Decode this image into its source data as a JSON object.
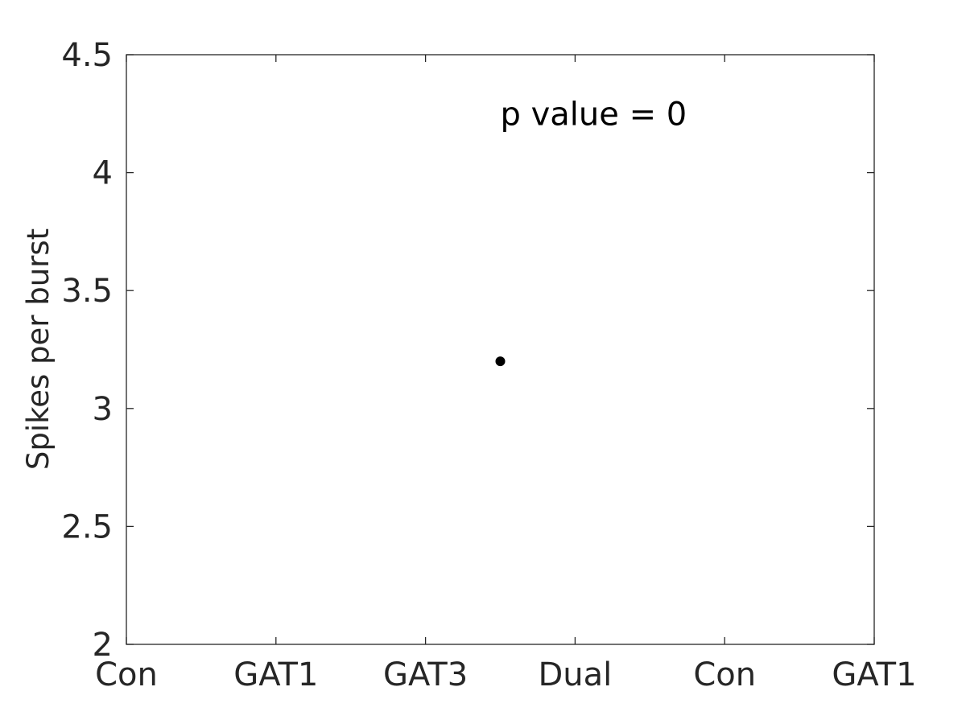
{
  "chart_data": {
    "type": "scatter",
    "title": "",
    "xlabel": "",
    "ylabel": "Spikes per burst",
    "x_tick_labels": [
      "Con",
      "GAT1",
      "GAT3",
      "Dual",
      "Con",
      "GAT1"
    ],
    "x_tick_positions": [
      0,
      1,
      2,
      3,
      4,
      5
    ],
    "xlim": [
      0,
      5
    ],
    "y_tick_labels": [
      "2",
      "2.5",
      "3",
      "3.5",
      "4",
      "4.5"
    ],
    "y_tick_values": [
      2,
      2.5,
      3,
      3.5,
      4,
      4.5
    ],
    "ylim": [
      2,
      4.5
    ],
    "grid": false,
    "series": [
      {
        "name": "data",
        "color": "#000000",
        "points": [
          {
            "x": 2.5,
            "y": 3.2
          }
        ]
      }
    ],
    "annotations": [
      {
        "text": "p value = 0",
        "x": 2.5,
        "y": 4.25
      }
    ],
    "axis_color": "#262626"
  }
}
